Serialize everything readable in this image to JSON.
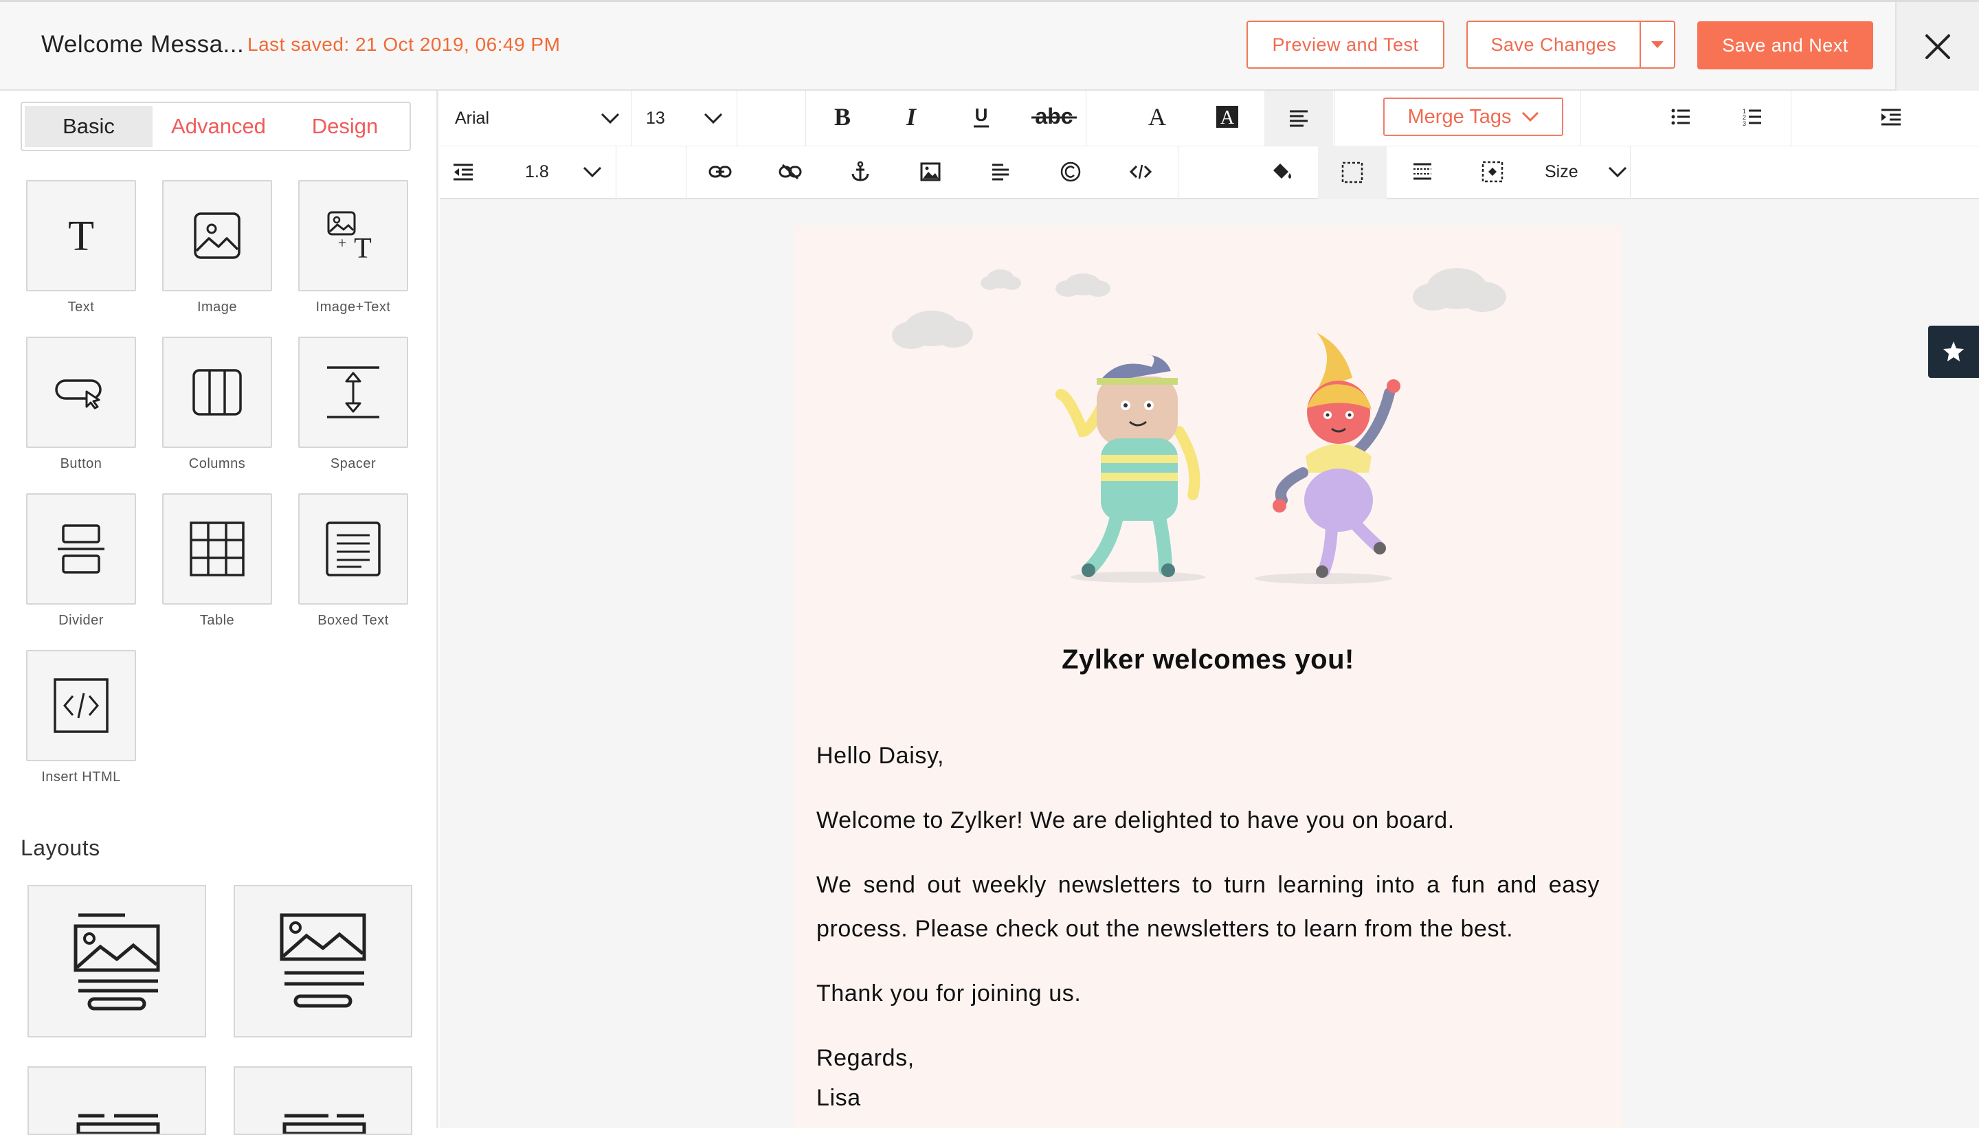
{
  "header": {
    "doc_title": "Welcome Messa...",
    "last_saved": "Last saved: 21 Oct 2019, 06:49 PM",
    "preview_label": "Preview and Test",
    "save_label": "Save Changes",
    "save_next_label": "Save and Next"
  },
  "sidebar": {
    "tabs": [
      "Basic",
      "Advanced",
      "Design"
    ],
    "active_tab": "Basic",
    "blocks": [
      {
        "label": "Text",
        "icon": "text-icon"
      },
      {
        "label": "Image",
        "icon": "image-icon"
      },
      {
        "label": "Image+Text",
        "icon": "image-text-icon"
      },
      {
        "label": "Button",
        "icon": "button-icon"
      },
      {
        "label": "Columns",
        "icon": "columns-icon"
      },
      {
        "label": "Spacer",
        "icon": "spacer-icon"
      },
      {
        "label": "Divider",
        "icon": "divider-icon"
      },
      {
        "label": "Table",
        "icon": "table-icon"
      },
      {
        "label": "Boxed Text",
        "icon": "boxed-text-icon"
      },
      {
        "label": "Insert HTML",
        "icon": "code-icon"
      }
    ],
    "layouts_title": "Layouts"
  },
  "toolbar": {
    "font_family": "Arial",
    "font_size": "13",
    "line_height": "1.8",
    "merge_tags_label": "Merge Tags",
    "size_label": "Size"
  },
  "email": {
    "heading": "Zylker welcomes you!",
    "greeting": "Hello Daisy,",
    "para1": "Welcome to Zylker! We are delighted to have you on board.",
    "para2": "We send out weekly newsletters to turn learning into a fun and easy process. Please check out the newsletters to learn from the best.",
    "para3": "Thank you for joining us.",
    "closing": "Regards,",
    "signature": "Lisa"
  },
  "colors": {
    "accent": "#f77354",
    "canvas_bg": "#f5f5f5",
    "email_bg": "#fdf4f2"
  }
}
